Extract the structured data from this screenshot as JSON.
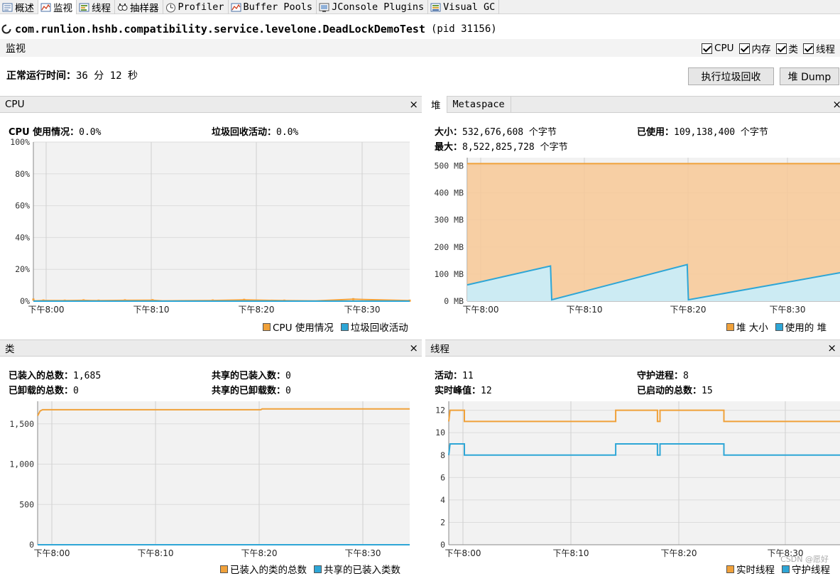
{
  "tabs": [
    {
      "label": "概述",
      "icon": "overview-icon",
      "active": false
    },
    {
      "label": "监视",
      "icon": "monitor-icon",
      "active": true
    },
    {
      "label": "线程",
      "icon": "threads-icon",
      "active": false
    },
    {
      "label": "抽样器",
      "icon": "sampler-icon",
      "active": false
    },
    {
      "label": "Profiler",
      "icon": "profiler-icon",
      "active": false
    },
    {
      "label": "Buffer Pools",
      "icon": "buffer-pools-icon",
      "active": false
    },
    {
      "label": "JConsole Plugins",
      "icon": "jconsole-icon",
      "active": false
    },
    {
      "label": "Visual GC",
      "icon": "visual-gc-icon",
      "active": false
    }
  ],
  "process": {
    "name": "com.runlion.hshb.compatibility.service.levelone.DeadLockDemoTest",
    "pid": "(pid 31156)"
  },
  "monitor": {
    "title": "监视",
    "checkboxes": [
      {
        "label": "CPU",
        "checked": true
      },
      {
        "label": "内存",
        "checked": true
      },
      {
        "label": "类",
        "checked": true
      },
      {
        "label": "线程",
        "checked": true
      }
    ],
    "uptime_label": "正常运行时间：",
    "uptime_value": "36 分 12 秒",
    "gc_button": "执行垃圾回收",
    "heap_dump_button": "堆 Dump"
  },
  "colors": {
    "orange": "#f0a13a",
    "blue": "#2ea6d6",
    "orange_fill": "#f8c997",
    "blue_fill": "#c9ecf8"
  },
  "x_ticks": [
    "下午8:00",
    "下午8:10",
    "下午8:20",
    "下午8:30"
  ],
  "cpu": {
    "title": "CPU",
    "close": "×",
    "usage_label": "CPU 使用情况：",
    "usage_value": "0.0%",
    "gc_label": "垃圾回收活动：",
    "gc_value": "0.0%",
    "legend": [
      "CPU 使用情况",
      "垃圾回收活动"
    ],
    "chart_data": {
      "type": "line",
      "y_ticks": [
        "100%",
        "80%",
        "60%",
        "40%",
        "20%",
        "0%"
      ],
      "ylim": [
        0,
        100
      ],
      "series": [
        {
          "name": "CPU 使用情况",
          "values": [
            [
              0,
              1
            ],
            [
              1,
              0.2
            ],
            [
              8,
              0.4
            ],
            [
              25,
              0.3
            ],
            [
              40,
              0.5
            ],
            [
              52,
              0.3
            ],
            [
              73,
              0.5
            ],
            [
              95,
              0.6
            ],
            [
              103,
              0.2
            ],
            [
              143,
              0.4
            ],
            [
              168,
              0.8
            ],
            [
              200,
              0.3
            ],
            [
              225,
              0.2
            ],
            [
              255,
              1.2
            ],
            [
              300,
              0.3
            ]
          ]
        },
        {
          "name": "垃圾回收活动",
          "values": [
            [
              0,
              0
            ],
            [
              300,
              0
            ]
          ]
        }
      ]
    }
  },
  "heap": {
    "tab_heap": "堆",
    "tab_meta": "Metaspace",
    "close": "×",
    "size_label": "大小：",
    "size_value": "532,676,608 个字节",
    "used_label": "已使用：",
    "used_value": "109,138,400 个字节",
    "max_label": "最大：",
    "max_value": "8,522,825,728 个字节",
    "legend": [
      "堆 大小",
      "使用的 堆"
    ],
    "chart_data": {
      "type": "area",
      "y_ticks": [
        "500 MB",
        "400 MB",
        "300 MB",
        "200 MB",
        "100 MB",
        "0 MB"
      ],
      "ylim": [
        0,
        530
      ],
      "series": [
        {
          "name": "堆 大小",
          "values": [
            [
              0,
              508
            ],
            [
              300,
              508
            ]
          ]
        },
        {
          "name": "使用的 堆",
          "values": [
            [
              0,
              60
            ],
            [
              67,
              130
            ],
            [
              68,
              5
            ],
            [
              177,
              135
            ],
            [
              178,
              5
            ],
            [
              300,
              105
            ]
          ]
        }
      ]
    }
  },
  "classes": {
    "title": "类",
    "close": "×",
    "loaded_label": "已装入的总数：",
    "loaded_value": "1,685",
    "unloaded_label": "已卸载的总数：",
    "unloaded_value": "0",
    "shared_loaded_label": "共享的已装入数：",
    "shared_loaded_value": "0",
    "shared_unloaded_label": "共享的已卸载数：",
    "shared_unloaded_value": "0",
    "legend": [
      "已装入的类的总数",
      "共享的已装入类数"
    ],
    "chart_data": {
      "type": "line",
      "y_ticks": [
        "1,500",
        "1,000",
        "500",
        "0"
      ],
      "ylim": [
        0,
        1780
      ],
      "series": [
        {
          "name": "已装入的类的总数",
          "values": [
            [
              0,
              1600
            ],
            [
              2,
              1660
            ],
            [
              4,
              1675
            ],
            [
              180,
              1675
            ],
            [
              181,
              1685
            ],
            [
              300,
              1685
            ]
          ]
        },
        {
          "name": "共享的已装入类数",
          "values": [
            [
              0,
              0
            ],
            [
              300,
              0
            ]
          ]
        }
      ]
    }
  },
  "threads": {
    "title": "线程",
    "close": "×",
    "live_label": "活动：",
    "live_value": "11",
    "peak_label": "实时峰值：",
    "peak_value": "12",
    "daemon_label": "守护进程：",
    "daemon_value": "8",
    "started_label": "已启动的总数：",
    "started_value": "15",
    "legend": [
      "实时线程",
      "守护线程"
    ],
    "chart_data": {
      "type": "line",
      "y_ticks": [
        "12",
        "10",
        "8",
        "6",
        "4",
        "2",
        "0"
      ],
      "ylim": [
        0,
        12.8
      ],
      "series": [
        {
          "name": "实时线程",
          "values": [
            [
              0,
              11
            ],
            [
              1,
              12
            ],
            [
              12,
              12
            ],
            [
              12,
              11
            ],
            [
              128,
              11
            ],
            [
              128,
              12
            ],
            [
              160,
              12
            ],
            [
              160,
              11
            ],
            [
              162,
              11
            ],
            [
              162,
              12
            ],
            [
              211,
              12
            ],
            [
              211,
              11
            ],
            [
              300,
              11
            ]
          ]
        },
        {
          "name": "守护线程",
          "values": [
            [
              0,
              8
            ],
            [
              1,
              9
            ],
            [
              12,
              9
            ],
            [
              12,
              8
            ],
            [
              128,
              8
            ],
            [
              128,
              9
            ],
            [
              160,
              9
            ],
            [
              160,
              8
            ],
            [
              162,
              8
            ],
            [
              162,
              9
            ],
            [
              211,
              9
            ],
            [
              211,
              8
            ],
            [
              300,
              8
            ]
          ]
        }
      ]
    }
  },
  "watermark": "CSDN @愿好"
}
